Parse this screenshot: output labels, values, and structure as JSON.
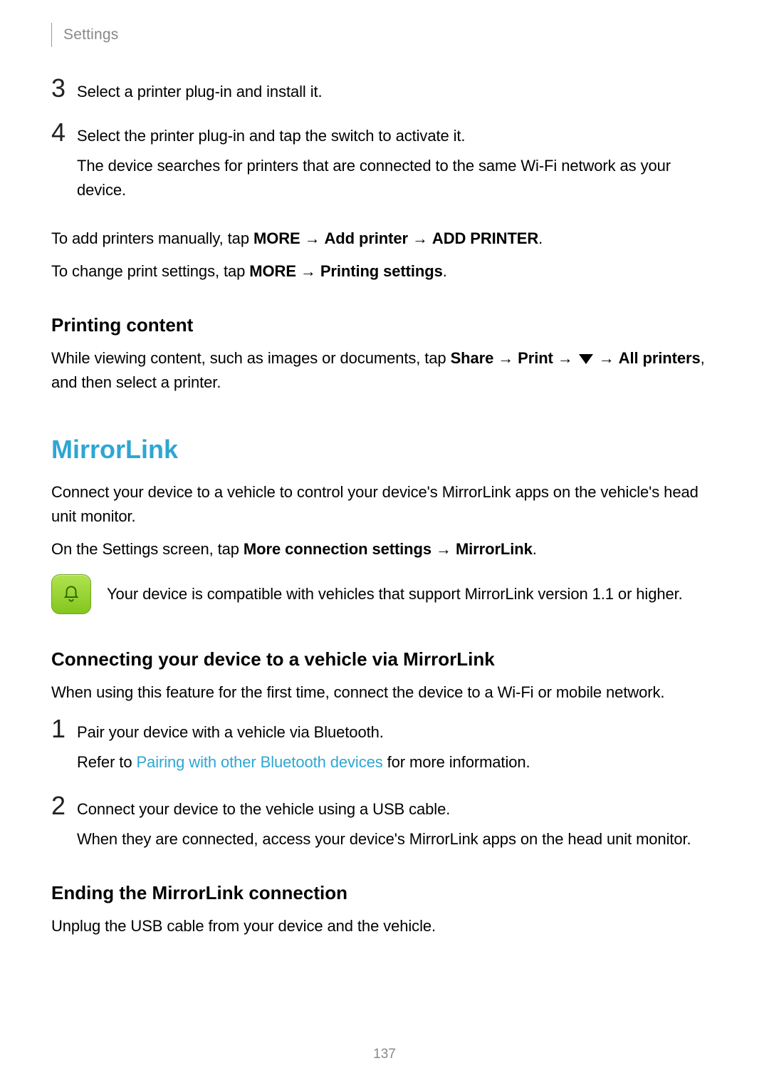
{
  "header": "Settings",
  "steps_top": [
    {
      "num": "3",
      "lines": [
        "Select a printer plug-in and install it."
      ]
    },
    {
      "num": "4",
      "lines": [
        "Select the printer plug-in and tap the switch to activate it.",
        "The device searches for printers that are connected to the same Wi-Fi network as your device."
      ]
    }
  ],
  "add_printers": {
    "pre": "To add printers manually, tap ",
    "b1": "MORE",
    "arr1": " → ",
    "b2": "Add printer",
    "arr2": " → ",
    "b3": "ADD PRINTER",
    "end": "."
  },
  "change_settings": {
    "pre": "To change print settings, tap ",
    "b1": "MORE",
    "arr1": " → ",
    "b2": "Printing settings",
    "end": "."
  },
  "printing_content": {
    "heading": "Printing content",
    "pre": "While viewing content, such as images or documents, tap ",
    "b1": "Share",
    "arr1": " → ",
    "b2": "Print",
    "arr2": " → ",
    "arr3": " → ",
    "b3": "All printers",
    "end": ", and then select a printer."
  },
  "mirrorlink": {
    "heading": "MirrorLink",
    "intro": "Connect your device to a vehicle to control your device's MirrorLink apps on the vehicle's head unit monitor.",
    "nav_pre": "On the Settings screen, tap ",
    "nav_b1": "More connection settings",
    "nav_arr": " → ",
    "nav_b2": "MirrorLink",
    "nav_end": ".",
    "note": "Your device is compatible with vehicles that support MirrorLink version 1.1 or higher.",
    "connect_heading": "Connecting your device to a vehicle via MirrorLink",
    "connect_intro": "When using this feature for the first time, connect the device to a Wi-Fi or mobile network.",
    "steps": [
      {
        "num": "1",
        "line1": "Pair your device with a vehicle via Bluetooth.",
        "line2_pre": "Refer to ",
        "line2_link": "Pairing with other Bluetooth devices",
        "line2_post": " for more information."
      },
      {
        "num": "2",
        "line1": "Connect your device to the vehicle using a USB cable.",
        "line2": "When they are connected, access your device's MirrorLink apps on the head unit monitor."
      }
    ],
    "end_heading": "Ending the MirrorLink connection",
    "end_text": "Unplug the USB cable from your device and the vehicle."
  },
  "page_number": "137"
}
